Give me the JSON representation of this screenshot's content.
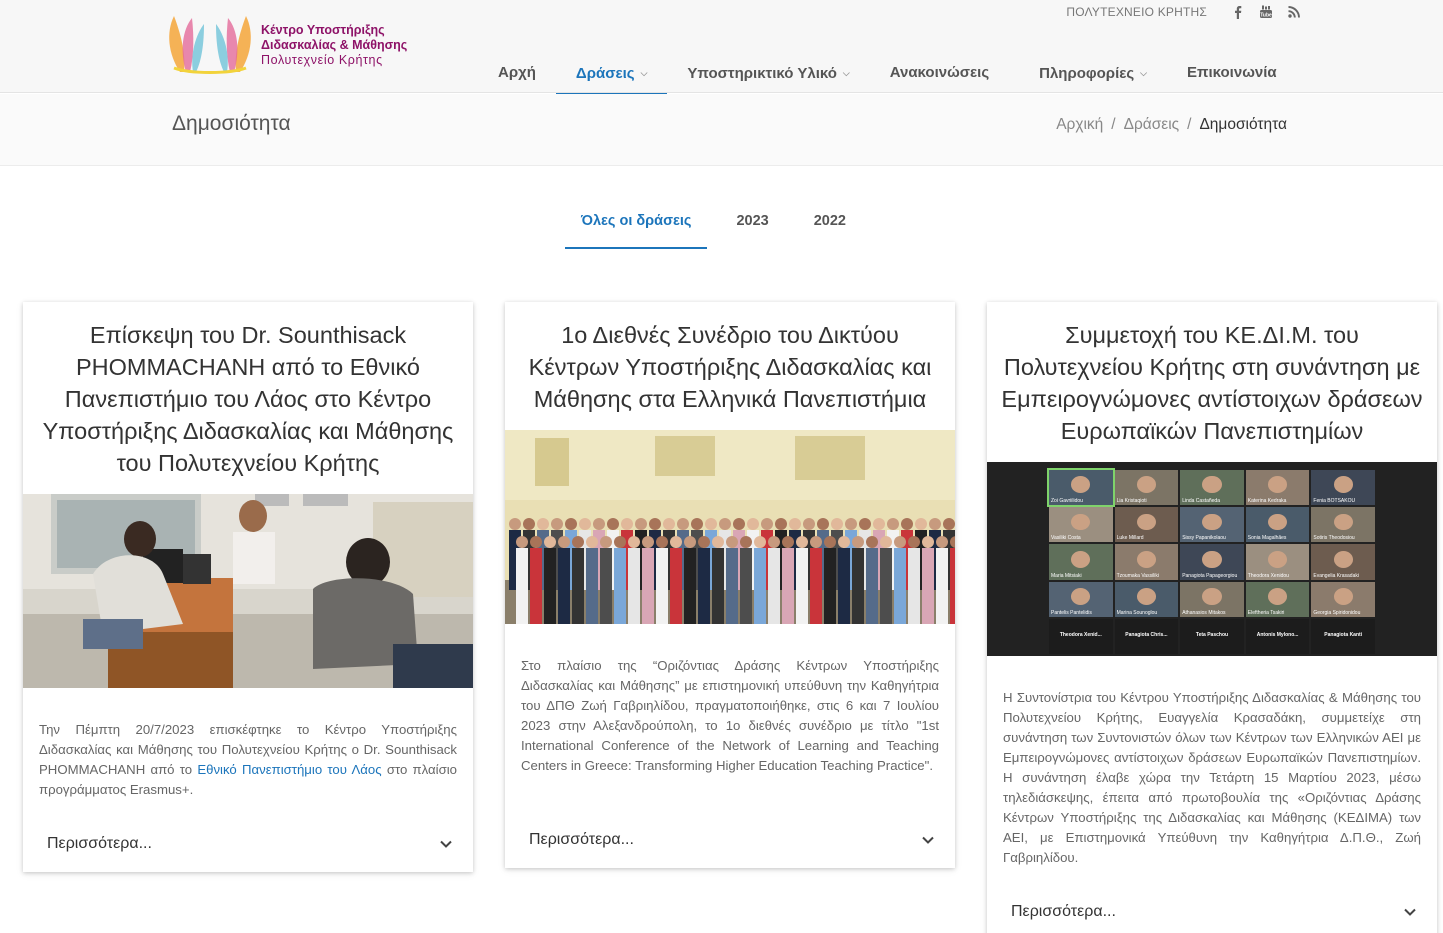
{
  "logo": {
    "line1": "Κέντρο Υποστήριξης",
    "line2": "Διδασκαλίας & Μάθησης",
    "line3": "Πολυτεχνείο Κρήτης"
  },
  "toplinks": {
    "university": "ΠΟΛΥΤΕΧΝΕΙΟ ΚΡΗΤΗΣ",
    "social_icons": [
      "facebook-icon",
      "youtube-icon",
      "rss-icon"
    ]
  },
  "nav": {
    "items": [
      {
        "label": "Αρχή",
        "has_dropdown": false
      },
      {
        "label": "Δράσεις",
        "has_dropdown": true,
        "active": true
      },
      {
        "label": "Υποστηρικτικό Υλικό",
        "has_dropdown": true
      },
      {
        "label": "Ανακοινώσεις",
        "has_dropdown": false
      },
      {
        "label": "Πληροφορίες",
        "has_dropdown": true
      },
      {
        "label": "Επικοινωνία",
        "has_dropdown": false
      }
    ]
  },
  "page": {
    "title": "Δημοσιότητα",
    "breadcrumb": [
      "Αρχική",
      "Δράσεις",
      "Δημοσιότητα"
    ],
    "breadcrumb_sep": "/"
  },
  "filters": {
    "tabs": [
      "Όλες οι δράσεις",
      "2023",
      "2022"
    ],
    "active": 0
  },
  "cards": [
    {
      "title": "Επίσκεψη του Dr. Sounthisack PHOMMACHANH από το Εθνικό Πανεπιστήμιο του Λάος στο Κέντρο Υποστήριξης Διδασκαλίας και Μάθησης του Πολυτεχνείου Κρήτης",
      "text_before_link": "Την Πέμπτη 20/7/2023 επισκέφτηκε το Κέντρο Υποστήριξης Διδασκαλίας και Μάθησης του Πολυτεχνείου Κρήτης ο Dr. Sounthisack PHOMMACHANH από το ",
      "link": "Εθνικό Πανεπιστήμιο του Λάος",
      "text_after_link": " στο πλαίσιο προγράμματος Erasmus+.",
      "more": "Περισσότερα..."
    },
    {
      "title": "1ο Διεθνές Συνέδριο του Δικτύου Κέντρων Υποστήριξης Διδασκαλίας και Μάθησης στα Ελληνικά Πανεπιστήμια",
      "text": "Στο πλαίσιο της “Οριζόντιας Δράσης Κέντρων Υποστήριξης Διδασκαλίας και Μάθησης” με επιστημονική υπεύθυνη την Καθηγήτρια του ΔΠΘ Ζωή Γαβριηλίδου, πραγματοποιήθηκε, στις 6 και 7 Ιουλίου 2023 στην Αλεξανδρούπολη, το 1ο διεθνές συνέδριο με τίτλο \"1st International Conference of the Network of Learning and Teaching Centers in Greece: Transforming Higher Education Teaching Practice\".",
      "more": "Περισσότερα..."
    },
    {
      "title": "Συμμετοχή του ΚΕ.ΔΙ.Μ. του Πολυτεχνείου Κρήτης στη συνάντηση με Εμπειρογνώμονες αντίστοιχων δράσεων Ευρωπαϊκών Πανεπιστημίων",
      "text": "Η Συντονίστρια του Κέντρου Υποστήριξης Διδασκαλίας & Μάθησης του Πολυτεχνείου Κρήτης, Ευαγγελία Κρασαδάκη, συμμετείχε στη συνάντηση των Συντονιστών όλων των Κέντρων των Ελληνικών ΑΕΙ με Εμπειρογνώμονες αντίστοιχων δράσεων Ευρωπαϊκών Πανεπιστημίων. Η συνάντηση έλαβε χώρα την Τετάρτη 15 Μαρτίου 2023, μέσω τηλεδιάσκεψης, έπειτα από πρωτοβουλία της «Οριζόντιας Δράσης Κέντρων Υποστήριξης της Διδασκαλίας και Μάθησης (ΚΕΔΙΜΑ) των ΑΕΙ, με Επιστημονικά Υπεύθυνη την Καθηγήτρια Δ.Π.Θ., Ζωή Γαβριηλίδου.",
      "more": "Περισσότερα..."
    }
  ],
  "video_call_participants": [
    "Zoi Gavriilidou",
    "Lia Kristaqioti",
    "Linda Castañeda",
    "Katerina Kedraka",
    "Fenia BOTSAKOU",
    "Vasiliki Costa",
    "Luke Millard",
    "Sissy Papanikolaou",
    "Sonia Magalhães",
    "Sotiris Theodosiou",
    "Maria Mitsiaki",
    "Tzoumaka Vassiliki",
    "Panagiota Papageorgiou",
    "Theodora Xenidou",
    "Evangelia Krasadaki",
    "Pantelis Pantelidis",
    "Marina Sounoglou",
    "Athanasios Mitakos",
    "Eleftheria Tsakiri",
    "Georgia Spiridonidou",
    "Theodora Xenid...",
    "Panagiota Chris...",
    "Teta Paschou",
    "Antonis Mylono...",
    "Panagiota Kanti"
  ]
}
